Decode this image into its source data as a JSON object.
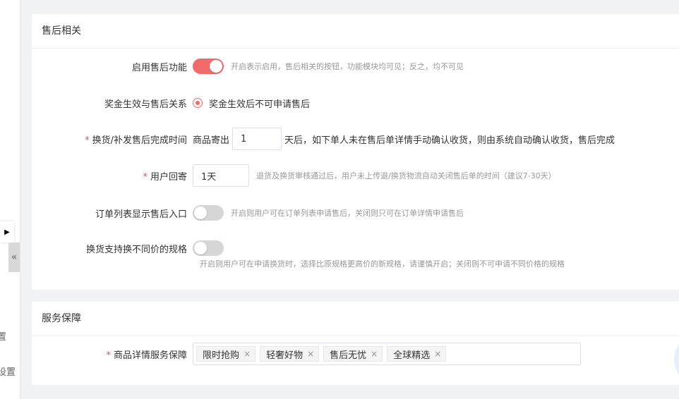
{
  "sidebar": {
    "label_1": "置",
    "label_2": "设置",
    "expand_arrow": "▶",
    "collapse_toggle": "«"
  },
  "after_sales": {
    "title": "售后相关",
    "enable": {
      "label": "启用售后功能",
      "state": "on",
      "hint": "开启表示启用，售后相关的按钮，功能模块均可见；反之，均不可见"
    },
    "bonus_relation": {
      "label": "奖金生效与售后关系",
      "option": "奖金生效后不可申请售后"
    },
    "exchange_complete_time": {
      "required_mark": "*",
      "label": "换货/补发售后完成时间",
      "prefix": "商品寄出",
      "value": "1",
      "suffix": "天后，如下单人未在售后单详情手动确认收货，则由系统自动确认收货，售后完成"
    },
    "user_return": {
      "required_mark": "*",
      "label": "用户回寄",
      "value": "1天",
      "hint": "退货及换货审核通过后，用户未上传退/换货物流自动关闭售后单的时间（建议7-30天）"
    },
    "order_list_entry": {
      "label": "订单列表显示售后入口",
      "state": "off",
      "hint": "开启则用户可在订单列表申请售后，关闭则只可在订单详情申请售后"
    },
    "exchange_diff_spec": {
      "label": "换货支持换不同价的规格",
      "state": "off",
      "hint": "开启则用户可在申请换货时，选择比原规格更高价的新规格，请谨慎开启；关闭则不可申请不同价格的规格"
    }
  },
  "service_guarantee": {
    "title": "服务保障",
    "detail_guarantee": {
      "required_mark": "*",
      "label": "商品详情服务保障",
      "tags": [
        "限时抢购",
        "轻奢好物",
        "售后无忧",
        "全球精选"
      ],
      "tag_close": "×"
    }
  }
}
